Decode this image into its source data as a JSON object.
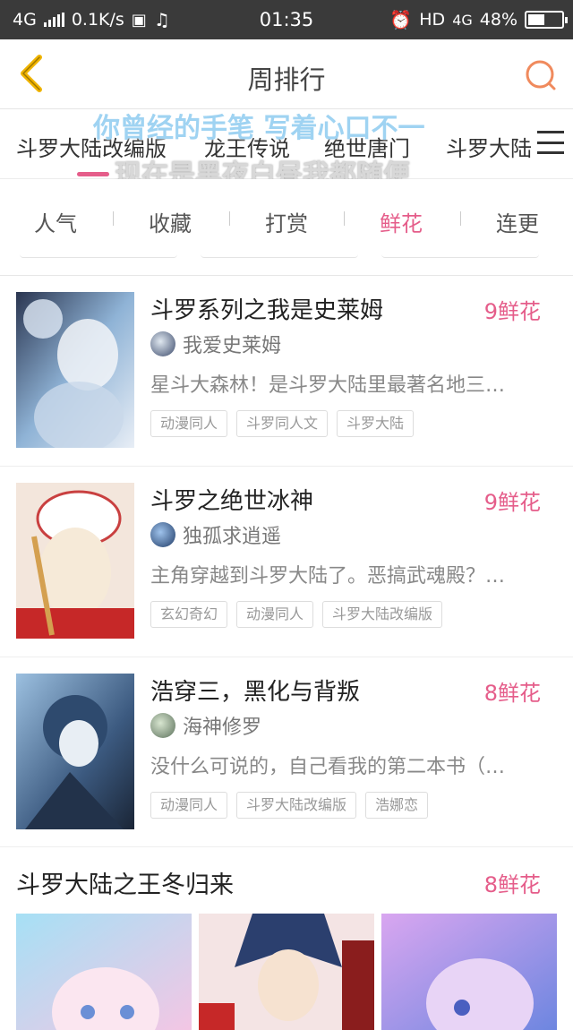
{
  "status_bar": {
    "network": "4G",
    "speed": "0.1K/s",
    "time": "01:35",
    "hd": "HD",
    "network2": "4G",
    "battery": "48%"
  },
  "nav": {
    "title": "周排行"
  },
  "categories": [
    "斗罗大陆改编版",
    "龙王传说",
    "绝世唐门",
    "斗罗大陆"
  ],
  "overlay_lyrics": {
    "line1": "你曾经的手笔 写着心口不一",
    "line2": "现在是黑夜白昼我都随便"
  },
  "sort_tabs": [
    "人气",
    "收藏",
    "打赏",
    "鲜花",
    "连更"
  ],
  "active_sort": "鲜花",
  "books": [
    {
      "title": "斗罗系列之我是史莱姆",
      "flowers": "9鲜花",
      "author": "我爱史莱姆",
      "desc": "星斗大森林！是斗罗大陆里最著名地三…",
      "tags": [
        "动漫同人",
        "斗罗同人文",
        "斗罗大陆"
      ]
    },
    {
      "title": "斗罗之绝世冰神",
      "flowers": "9鲜花",
      "author": "独孤求逍遥",
      "desc": "主角穿越到斗罗大陆了。恶搞武魂殿？…",
      "tags": [
        "玄幻奇幻",
        "动漫同人",
        "斗罗大陆改编版"
      ]
    },
    {
      "title": "浩穿三，黑化与背叛",
      "flowers": "8鲜花",
      "author": "海神修罗",
      "desc": "没什么可说的，自己看我的第二本书（…",
      "tags": [
        "动漫同人",
        "斗罗大陆改编版",
        "浩娜恋"
      ]
    }
  ],
  "featured": {
    "title": "斗罗大陆之王冬归来",
    "flowers": "8鲜花"
  },
  "colors": {
    "accent": "#e55d8a",
    "back_arrow": "#f0b400",
    "search": "#f08a5d"
  }
}
